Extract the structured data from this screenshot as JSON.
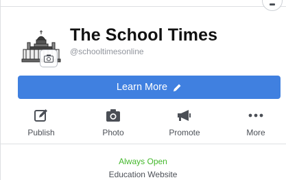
{
  "page": {
    "title": "The School Times",
    "handle": "@schooltimesonline"
  },
  "primary_button": {
    "label": "Learn More",
    "icon": "pencil-icon",
    "color": "#4080e0"
  },
  "actions": [
    {
      "label": "Publish",
      "icon": "compose-icon"
    },
    {
      "label": "Photo",
      "icon": "camera-icon"
    },
    {
      "label": "Promote",
      "icon": "megaphone-icon"
    },
    {
      "label": "More",
      "icon": "more-dots-icon"
    }
  ],
  "info": {
    "status": "Always Open",
    "status_color": "#42b72a",
    "category": "Education Website"
  }
}
